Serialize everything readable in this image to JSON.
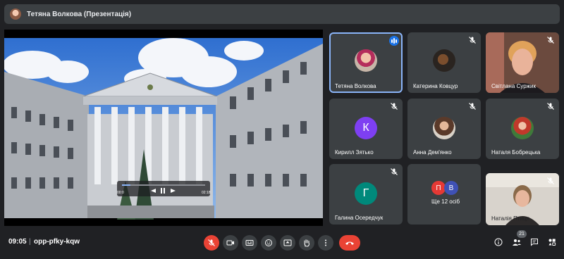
{
  "presenter": {
    "title": "Тетяна Волкова (Презентація)"
  },
  "video_player": {
    "time_current": "00:0",
    "time_total": "02:18",
    "progress": 0.1
  },
  "participants": [
    {
      "name": "Тетяна Волкова",
      "speaking": true
    },
    {
      "name": "Катерина Ковцур",
      "muted": true
    },
    {
      "name": "Світлана Суржик",
      "muted": true
    },
    {
      "name": "Кирилл Зятько",
      "initial": "К",
      "avatar_color": "#7e3ff2",
      "muted": true
    },
    {
      "name": "Анна Дем'янко",
      "muted": true
    },
    {
      "name": "Наталя Бобрецька",
      "muted": true
    },
    {
      "name": "Галина Осередчук",
      "initial": "Г",
      "avatar_color": "#00897b",
      "muted": true
    },
    {
      "name": "Ще 12 осіб",
      "initials": [
        "П",
        "В"
      ],
      "avatar_colors": [
        "#e53935",
        "#3f51b5"
      ]
    },
    {
      "name": "Наталія Птиця",
      "muted": true
    }
  ],
  "meeting": {
    "time": "09:05",
    "code": "opp-pfky-kqw",
    "separator": "|",
    "participant_count": "21"
  },
  "colors": {
    "accent": "#8ab4f8",
    "danger": "#ea4335",
    "tile": "#3c4043",
    "background": "#202124"
  }
}
